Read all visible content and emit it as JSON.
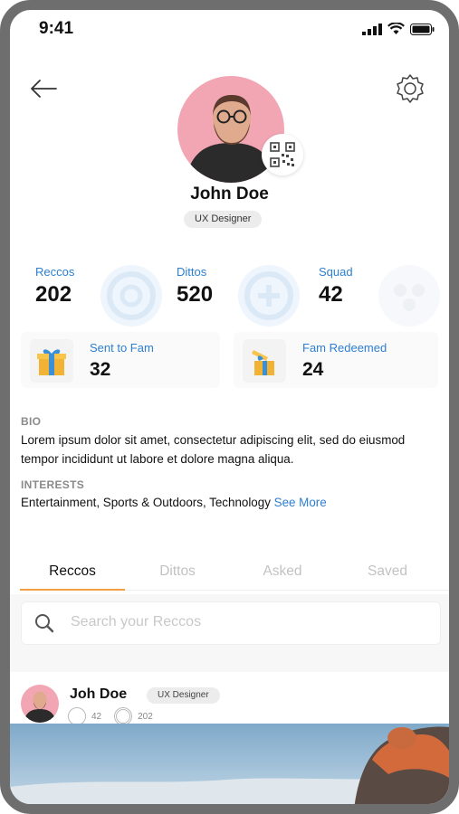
{
  "status_bar": {
    "time": "9:41"
  },
  "profile": {
    "name": "John Doe",
    "role": "UX Designer"
  },
  "stats": [
    {
      "label": "Reccos",
      "value": "202"
    },
    {
      "label": "Dittos",
      "value": "520"
    },
    {
      "label": "Squad",
      "value": "42"
    }
  ],
  "fam": [
    {
      "label": "Sent to Fam",
      "value": "32"
    },
    {
      "label": "Fam Redeemed",
      "value": "24"
    }
  ],
  "bio": {
    "heading": "BIO",
    "text": "Lorem ipsum dolor sit amet, consectetur adipiscing elit, sed do eiusmod tempor incididunt ut labore et dolore magna aliqua."
  },
  "interests": {
    "heading": "INTERESTS",
    "text": "Entertainment, Sports & Outdoors, Technology",
    "see_more": "See More"
  },
  "tabs": [
    "Reccos",
    "Dittos",
    "Asked",
    "Saved"
  ],
  "search": {
    "placeholder": "Search your Reccos"
  },
  "post": {
    "name": "Joh Doe",
    "badge": "UX Designer",
    "stat1": "42",
    "stat2": "202"
  },
  "icons": {
    "back": "arrow-left-icon",
    "settings": "gear-icon",
    "qr": "qr-code-icon",
    "search": "search-icon",
    "gift": "gift-icon",
    "redeemed": "gift-open-icon"
  },
  "colors": {
    "accent": "#2d7fd0",
    "tab_indicator": "#f0a040",
    "avatar_bg": "#f2a6b4"
  }
}
